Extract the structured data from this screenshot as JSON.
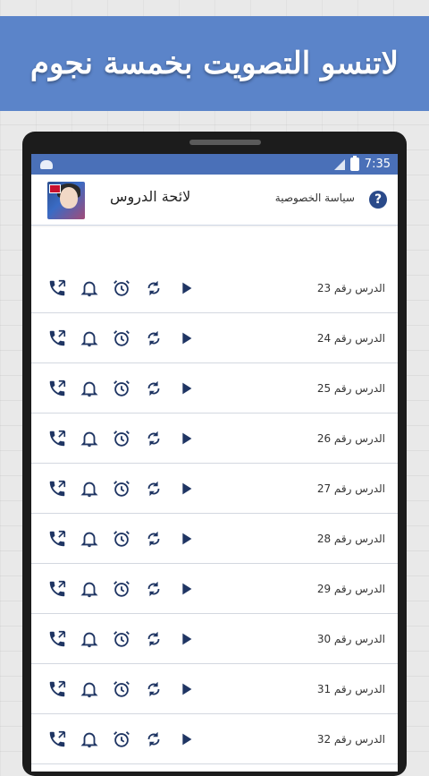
{
  "banner": {
    "text": "لاتنسو التصويت بخمسة نجوم"
  },
  "status_bar": {
    "time": "7:35"
  },
  "app_bar": {
    "title": "لائحة الدروس",
    "privacy_label": "سياسة الخصوصية",
    "help_glyph": "?"
  },
  "lessons": [
    {
      "label": "الدرس رقم 23"
    },
    {
      "label": "الدرس رقم 24"
    },
    {
      "label": "الدرس رقم 25"
    },
    {
      "label": "الدرس رقم 26"
    },
    {
      "label": "الدرس رقم 27"
    },
    {
      "label": "الدرس رقم 28"
    },
    {
      "label": "الدرس رقم 29"
    },
    {
      "label": "الدرس رقم 30"
    },
    {
      "label": "الدرس رقم 31"
    },
    {
      "label": "الدرس رقم 32"
    }
  ],
  "row_icons": [
    "phone-ringtone-icon",
    "bell-notification-icon",
    "alarm-clock-icon",
    "repeat-icon",
    "play-icon"
  ],
  "colors": {
    "banner": "#5b84c9",
    "status_bar": "#4a70b8",
    "icon": "#1f3563"
  }
}
